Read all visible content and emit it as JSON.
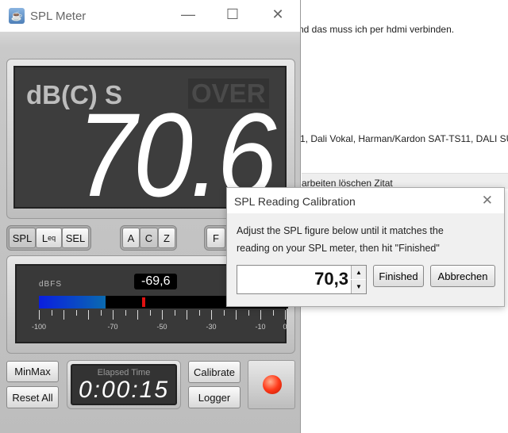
{
  "background": {
    "line1": "nd das muss ich per hdmi verbinden.",
    "line2": "1, Dali Vokal, Harman/Kardon SAT-TS11, DALI SU",
    "toolbar": "arbeiten    löschen    Zitat"
  },
  "window": {
    "title": "SPL Meter",
    "minimize": "—",
    "maximize": "☐",
    "close": "✕"
  },
  "display": {
    "weighting": "dB(C) S",
    "over": "OVER",
    "value": "70.6"
  },
  "mode_buttons": [
    "SPL",
    "L",
    "SEL"
  ],
  "leq_sub": "eq",
  "weight_buttons": [
    "A",
    "C",
    "Z"
  ],
  "speed_buttons": [
    "F"
  ],
  "meter": {
    "unit_label": "dBFS",
    "value": "-69,6",
    "level_dbfs": -69.6,
    "peak_dbfs": -58,
    "ticks": [
      "-100",
      "-70",
      "-50",
      "-30",
      "-10",
      "0"
    ]
  },
  "buttons": {
    "minmax": "MinMax",
    "reset": "Reset All",
    "calibrate": "Calibrate",
    "logger": "Logger"
  },
  "elapsed": {
    "label": "Elapsed Time",
    "value": "0:00:15"
  },
  "colors": {
    "led": "#ff3a1a",
    "bar": "#0a1ee0"
  },
  "dialog": {
    "title": "SPL Reading Calibration",
    "line1": "Adjust the SPL figure below until it matches the",
    "line2": "reading on your SPL meter, then hit \"Finished\"",
    "value": "70,3",
    "finished": "Finished",
    "cancel": "Abbrechen",
    "close": "✕"
  }
}
